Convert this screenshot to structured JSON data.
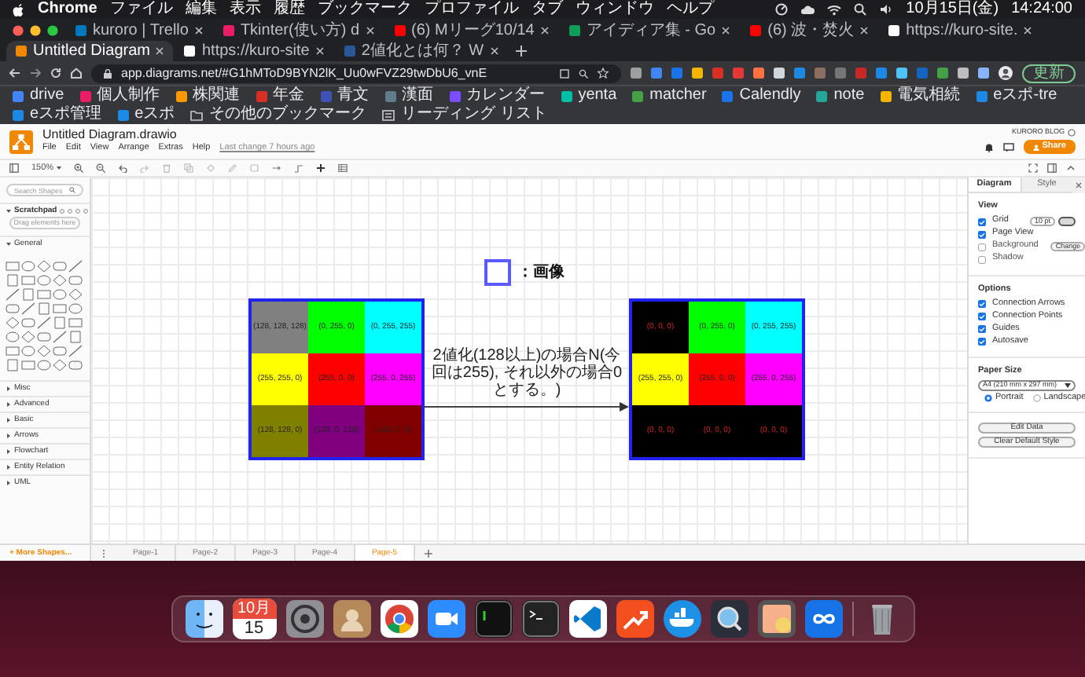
{
  "menubar": {
    "app": "Chrome",
    "items": [
      "ファイル",
      "編集",
      "表示",
      "履歴",
      "ブックマーク",
      "プロファイル",
      "タブ",
      "ウィンドウ",
      "ヘルプ"
    ],
    "date": "10月15日(金)",
    "time": "14:24:00"
  },
  "tabs": [
    {
      "title": "kuroro | Trello",
      "selected": false
    },
    {
      "title": "Tkinter(使い方) d",
      "selected": false
    },
    {
      "title": "(6) Mリーグ10/14",
      "selected": false
    },
    {
      "title": "アイディア集 - Go",
      "selected": false
    },
    {
      "title": "(6) 波・焚火",
      "selected": false
    },
    {
      "title": "https://kuro-site.",
      "selected": false
    },
    {
      "title": "Untitled Diagram",
      "selected": true
    },
    {
      "title": "https://kuro-site",
      "selected": false
    },
    {
      "title": "2値化とは何？ W",
      "selected": false
    }
  ],
  "address": {
    "url": "app.diagrams.net/#G1hMToD9BYN2lK_Uu0wFVZ29twDbU6_vnE",
    "update_button": "更新"
  },
  "bookmarks": [
    "drive",
    "個人制作",
    "株関連",
    "年金",
    "青文",
    "漢面",
    "カレンダー",
    "yenta",
    "matcher",
    "Calendly",
    "note",
    "電気相続",
    "eスポ-tre",
    "eスポ管理",
    "eスポ"
  ],
  "bookmarks_right": [
    "その他のブックマーク",
    "リーディング リスト"
  ],
  "app": {
    "title": "Untitled Diagram.drawio",
    "menu": [
      "File",
      "Edit",
      "View",
      "Arrange",
      "Extras",
      "Help"
    ],
    "last_change": "Last change 7 hours ago",
    "user": "KURORO BLOG",
    "share": "Share",
    "zoom": "150%"
  },
  "sidebar": {
    "search_placeholder": "Search Shapes",
    "scratchpad": "Scratchpad",
    "scratchpad_hint": "Drag elements here",
    "sections": [
      {
        "label": "General",
        "expanded": true
      },
      {
        "label": "Misc",
        "expanded": false
      },
      {
        "label": "Advanced",
        "expanded": false
      },
      {
        "label": "Basic",
        "expanded": false
      },
      {
        "label": "Arrows",
        "expanded": false
      },
      {
        "label": "Flowchart",
        "expanded": false
      },
      {
        "label": "Entity Relation",
        "expanded": false
      },
      {
        "label": "UML",
        "expanded": false
      }
    ],
    "more_shapes": "+ More Shapes..."
  },
  "canvas": {
    "legend_label": "：画像",
    "edge_label": "2値化(128以上)の場合N(今回は255), それ以外の場合0とする。)",
    "left_grid": [
      {
        "label": "(128, 128, 128)",
        "color": "#808080"
      },
      {
        "label": "(0, 255, 0)",
        "color": "#00ff00"
      },
      {
        "label": "(0, 255, 255)",
        "color": "#00ffff"
      },
      {
        "label": "(255, 255, 0)",
        "color": "#ffff00"
      },
      {
        "label": "(255, 0, 0)",
        "color": "#ff0000"
      },
      {
        "label": "(255, 0, 255)",
        "color": "#ff00ff"
      },
      {
        "label": "(128, 128, 0)",
        "color": "#808000"
      },
      {
        "label": "(128, 0, 128)",
        "color": "#800080"
      },
      {
        "label": "(128, 0, 0)",
        "color": "#800000"
      }
    ],
    "right_grid": [
      {
        "label": "(0, 0, 0)",
        "color": "#000000"
      },
      {
        "label": "(0, 255, 0)",
        "color": "#00ff00"
      },
      {
        "label": "(0, 255, 255)",
        "color": "#00ffff"
      },
      {
        "label": "(255, 255, 0)",
        "color": "#ffff00"
      },
      {
        "label": "(255, 0, 0)",
        "color": "#ff0000"
      },
      {
        "label": "(255, 0, 255)",
        "color": "#ff00ff"
      },
      {
        "label": "(0, 0, 0)",
        "color": "#000000"
      },
      {
        "label": "(0, 0, 0)",
        "color": "#000000"
      },
      {
        "label": "(0, 0, 0)",
        "color": "#000000"
      }
    ]
  },
  "format": {
    "tabs": [
      {
        "label": "Diagram",
        "selected": true
      },
      {
        "label": "Style",
        "selected": false
      }
    ],
    "view_heading": "View",
    "view": [
      {
        "label": "Grid",
        "checked": true
      },
      {
        "label": "Page View",
        "checked": true
      },
      {
        "label": "Background",
        "checked": false
      },
      {
        "label": "Shadow",
        "checked": false
      }
    ],
    "grid_size": "10 pt",
    "background_button": "Change",
    "options_heading": "Options",
    "options": [
      {
        "label": "Connection Arrows",
        "checked": true
      },
      {
        "label": "Connection Points",
        "checked": true
      },
      {
        "label": "Guides",
        "checked": true
      },
      {
        "label": "Autosave",
        "checked": true
      }
    ],
    "paper_heading": "Paper Size",
    "paper_size": "A4 (210 mm x 297 mm)",
    "orientation": [
      {
        "label": "Portrait",
        "selected": true
      },
      {
        "label": "Landscape",
        "selected": false
      }
    ],
    "buttons": [
      "Edit Data",
      "Clear Default Style"
    ]
  },
  "pages": [
    {
      "label": "Page-1",
      "selected": false
    },
    {
      "label": "Page-2",
      "selected": false
    },
    {
      "label": "Page-3",
      "selected": false
    },
    {
      "label": "Page-4",
      "selected": false
    },
    {
      "label": "Page-5",
      "selected": true
    }
  ],
  "dock": {
    "calendar_month": "10月",
    "calendar_day": "15"
  }
}
